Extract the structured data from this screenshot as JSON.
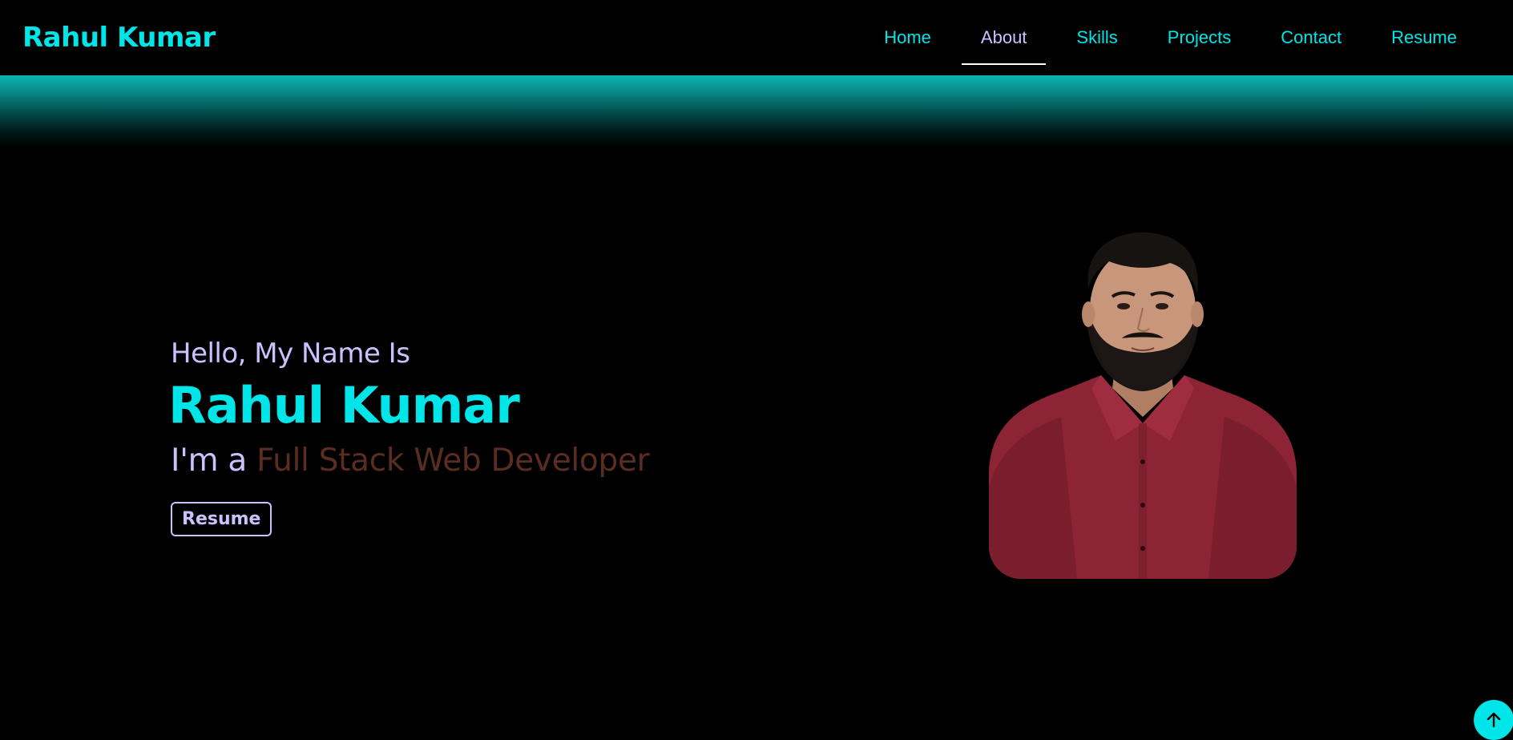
{
  "navbar": {
    "brand": "Rahul Kumar",
    "links": [
      {
        "label": "Home"
      },
      {
        "label": "About",
        "active": true
      },
      {
        "label": "Skills"
      },
      {
        "label": "Projects"
      },
      {
        "label": "Contact"
      },
      {
        "label": "Resume"
      }
    ]
  },
  "hero": {
    "greeting": "Hello, My Name Is",
    "name": "Rahul Kumar",
    "role_prefix": "I'm a ",
    "role": "Full Stack Web Developer",
    "resume_button": "Resume"
  },
  "scroll_top": {
    "icon": "arrow-up-icon"
  },
  "colors": {
    "background": "#000000",
    "accent": "#00e5e8",
    "lavender": "#c9c2ff",
    "role_text": "#5a2c22",
    "glow": "#0bb3b1"
  }
}
